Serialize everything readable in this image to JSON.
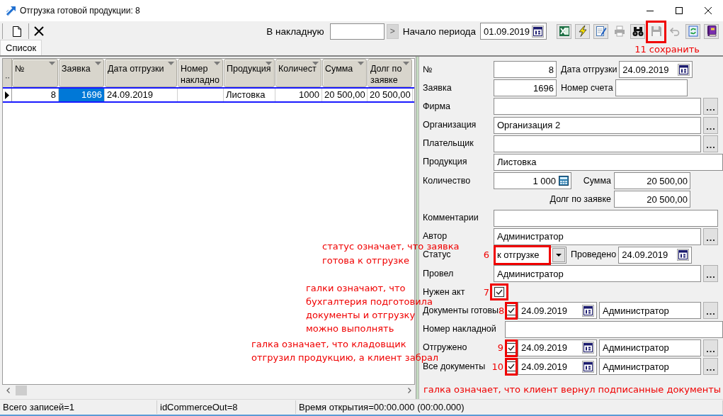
{
  "window": {
    "title": "Отгрузка готовой продукции: 8"
  },
  "toolbar": {
    "left_buttons": [
      {
        "kind": "new"
      },
      {
        "kind": "delete"
      }
    ],
    "invoice_label": "В накладную",
    "go_button": {
      "label": ">",
      "disabled": true
    },
    "period_label": "Начало периода",
    "period_start": "01.09.2019",
    "buttons": [
      {
        "kind": "excel",
        "disabled": false,
        "highlighted": false
      },
      {
        "kind": "run",
        "disabled": false,
        "highlighted": false
      },
      {
        "kind": "edit",
        "disabled": false,
        "highlighted": false
      },
      {
        "kind": "print",
        "disabled": true,
        "highlighted": false
      },
      {
        "kind": "find",
        "disabled": false,
        "highlighted": false
      },
      {
        "kind": "save",
        "disabled": true,
        "highlighted": true
      },
      {
        "kind": "undo",
        "disabled": true,
        "highlighted": false
      },
      {
        "kind": "refresh",
        "disabled": false,
        "highlighted": false
      },
      {
        "kind": "help",
        "disabled": false,
        "highlighted": false
      }
    ]
  },
  "save_note": "11 сохранить",
  "tabs": [
    {
      "label": "Список",
      "selected": true
    }
  ],
  "grid": {
    "columns": [
      "№",
      "Заявка",
      "Дата отгрузки",
      "Номер накладно",
      "Продукция",
      "Количест",
      "Сумма",
      "Долг по заявке"
    ],
    "rows": [
      {
        "selected": true,
        "cells": [
          {
            "text": "8",
            "focused": false
          },
          {
            "text": "1696",
            "focused": true
          },
          {
            "text": "24.09.2019",
            "focused": false
          },
          {
            "focused": false
          },
          {
            "text": "Листовка",
            "focused": false
          },
          {
            "text": "1000",
            "focused": false
          },
          {
            "text": "20 500,00",
            "focused": false
          },
          {
            "text": "20 500,00",
            "focused": false
          }
        ]
      }
    ]
  },
  "form": {
    "rows": [
      {
        "kind": "general",
        "label": "№",
        "controls": [
          {
            "kind": "number",
            "value": "8"
          },
          {
            "kind": "caption",
            "text": "Дата отгрузки"
          },
          {
            "kind": "date",
            "value": "24.09.2019"
          }
        ]
      },
      {
        "kind": "general",
        "label": "Заявка",
        "controls": [
          {
            "kind": "number",
            "value": "1696"
          },
          {
            "kind": "caption",
            "text": "Номер счета"
          },
          {
            "kind": "short"
          }
        ]
      },
      {
        "kind": "general",
        "label": "Фирма",
        "controls": [
          {
            "kind": "lookup"
          }
        ]
      },
      {
        "kind": "general",
        "label": "Организация",
        "controls": [
          {
            "kind": "lookup",
            "value": "Организация 2"
          }
        ]
      },
      {
        "kind": "general",
        "label": "Плательщик",
        "controls": [
          {
            "kind": "lookup"
          }
        ]
      },
      {
        "kind": "general",
        "label": "Продукция",
        "controls": [
          {
            "kind": "wide",
            "value": "Листовка"
          }
        ]
      },
      {
        "kind": "general",
        "label": "Количество",
        "controls": [
          {
            "kind": "calc",
            "value": "1 000"
          },
          {
            "kind": "caption",
            "text": "Сумма"
          },
          {
            "kind": "money",
            "value": "20 500,00"
          }
        ]
      },
      {
        "kind": "general",
        "controls": [
          {
            "kind": "caption",
            "text": "Долг по заявке"
          },
          {
            "kind": "money",
            "value": "20 500,00"
          }
        ]
      },
      {
        "kind": "general",
        "label": "Комментарии",
        "controls": [
          {
            "kind": "field"
          }
        ]
      },
      {
        "kind": "general",
        "label": "Автор",
        "controls": [
          {
            "kind": "lookup",
            "value": "Администратор"
          }
        ]
      },
      {
        "kind": "general",
        "label": "Статус",
        "marker": "6",
        "controls": [
          {
            "kind": "select",
            "value": "к отгрузке",
            "highlighted": true
          },
          {
            "kind": "caption",
            "text": "Проведено"
          },
          {
            "kind": "date",
            "value": "24.09.2019"
          }
        ]
      },
      {
        "kind": "general",
        "label": "Провел",
        "controls": [
          {
            "kind": "lookup",
            "value": "Администратор"
          }
        ]
      },
      {
        "kind": "general",
        "label": "Нужен акт",
        "marker": "7",
        "controls": [
          {
            "kind": "check",
            "checked": true,
            "highlighted": true
          }
        ]
      },
      {
        "kind": "tracking",
        "label": "Документы готовы",
        "marker": "8",
        "controls": [
          {
            "kind": "check",
            "checked": true,
            "highlighted": true
          },
          {
            "kind": "date",
            "value": "24.09.2019"
          },
          {
            "kind": "lookup",
            "value": "Администратор"
          }
        ]
      },
      {
        "kind": "tracking",
        "label": "Номер накладной",
        "controls": [
          {
            "kind": "wide"
          }
        ]
      },
      {
        "kind": "tracking",
        "label": "Отгружено",
        "marker": "9",
        "controls": [
          {
            "kind": "check",
            "checked": true,
            "highlighted": true
          },
          {
            "kind": "date",
            "value": "24.09.2019"
          },
          {
            "kind": "lookup",
            "value": "Администратор"
          }
        ]
      },
      {
        "kind": "tracking",
        "label": "Все документы",
        "marker": "10",
        "controls": [
          {
            "kind": "check",
            "checked": true,
            "highlighted": true
          },
          {
            "kind": "date",
            "value": "24.09.2019"
          },
          {
            "kind": "lookup",
            "value": "Администратор"
          }
        ]
      }
    ],
    "note": "галка означает, что клиент вернул подписанные документы"
  },
  "annotations": [
    {
      "lines": [
        "статус означает, что заявка",
        "готова к отгрузке"
      ]
    },
    {
      "lines": [
        "галки означают, что",
        "бухгалтерия подготовила",
        "документы и отгрузку",
        "можно выполнять"
      ]
    },
    {
      "lines": [
        "галка означает, что кладовщик",
        "отгрузил продукцию, а клиент забрал"
      ]
    }
  ],
  "status_bar": [
    "Всего записей=1",
    "idCommerceOut=8",
    "Время открытия=00:00.000 (00:00.000)"
  ]
}
